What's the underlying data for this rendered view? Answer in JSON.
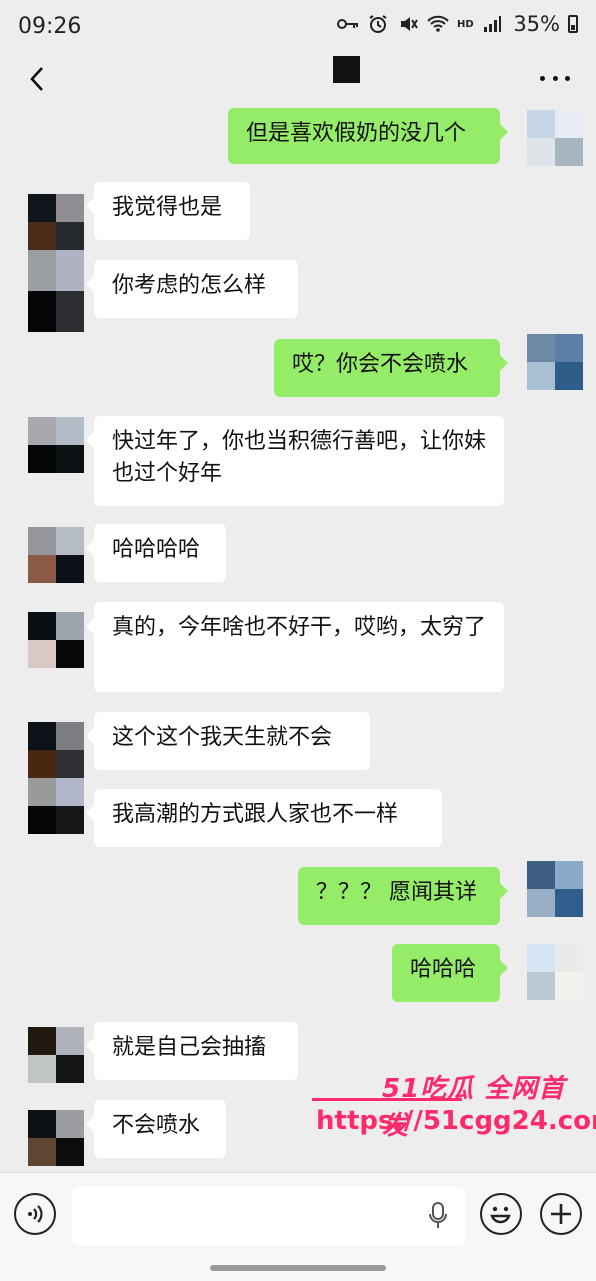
{
  "status": {
    "time": "09:26",
    "battery": "35%",
    "icons": [
      "key-icon",
      "alarm-icon",
      "mute-icon",
      "wifi-icon",
      "hd-icon",
      "signal-icon",
      "battery-icon"
    ]
  },
  "header": {
    "title": "",
    "back_icon": "chevron-left-icon",
    "more_icon": "more-icon"
  },
  "messages": [
    {
      "side": "out",
      "text": "但是喜欢假奶的没几个"
    },
    {
      "side": "in",
      "text": "我觉得也是"
    },
    {
      "side": "in",
      "text": "你考虑的怎么样"
    },
    {
      "side": "out",
      "text": "哎？你会不会喷水"
    },
    {
      "side": "in",
      "text": "快过年了，你也当积德行善吧，让你妹也过个好年"
    },
    {
      "side": "in",
      "text": "哈哈哈哈"
    },
    {
      "side": "in",
      "text": "真的，今年啥也不好干，哎哟，太穷了"
    },
    {
      "side": "in",
      "text": "这个这个我天生就不会"
    },
    {
      "side": "in",
      "text": "我高潮的方式跟人家也不一样"
    },
    {
      "side": "out",
      "text": "？？？ 愿闻其详"
    },
    {
      "side": "out",
      "text": "哈哈哈"
    },
    {
      "side": "in",
      "text": "就是自己会抽搐"
    },
    {
      "side": "in",
      "text": "不会喷水"
    }
  ],
  "watermark": {
    "line1": "51吃瓜 全网首发",
    "line2": "https://51cgg24.com"
  },
  "input": {
    "placeholder": "",
    "voice_icon": "voice-icon",
    "mic_icon": "mic-icon",
    "emoji_icon": "emoji-icon",
    "plus_icon": "plus-icon"
  },
  "colors": {
    "background": "#ededed",
    "outgoing_bubble": "#95ec69",
    "incoming_bubble": "#ffffff",
    "watermark": "#ff2a6b"
  }
}
